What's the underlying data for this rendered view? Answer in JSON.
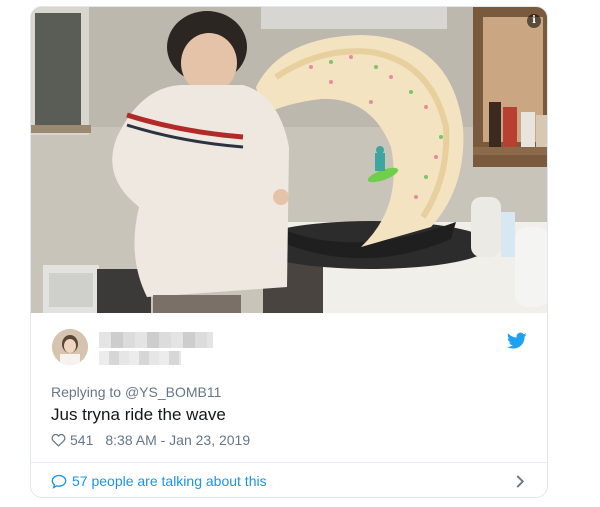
{
  "tweet": {
    "reply_prefix": "Replying to",
    "reply_to": "@YS_BOMB11",
    "text": "Jus tryna ride the wave",
    "like_count": "541",
    "timestamp": "8:38 AM - Jan 23, 2019",
    "conversation_link": "57 people are talking about this"
  },
  "icons": {
    "info": "info-icon",
    "brand": "twitter-bird-icon",
    "like": "heart-icon",
    "conversation": "speech-bubble-icon",
    "more": "chevron-right-icon"
  },
  "colors": {
    "link_blue": "#1b95e0",
    "twitter_blue": "#1da1f2",
    "muted_text": "#657786",
    "body_text": "#14171a"
  }
}
